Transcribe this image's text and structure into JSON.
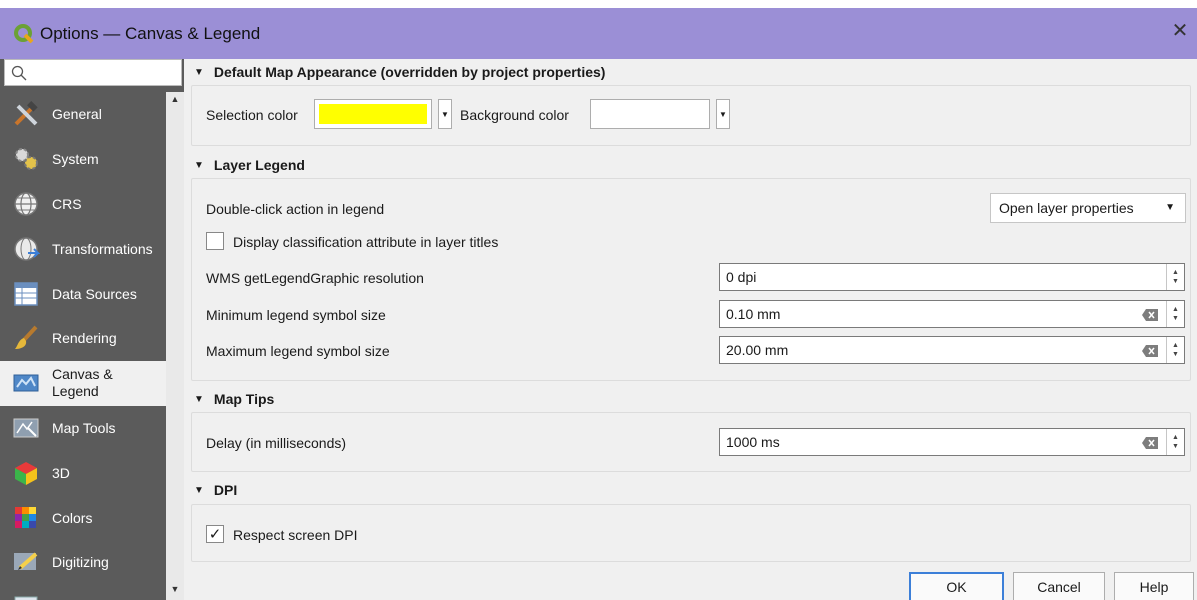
{
  "window": {
    "title": "Options — Canvas & Legend"
  },
  "search": {
    "placeholder": ""
  },
  "sidebar": {
    "items": [
      {
        "label": "General",
        "icon": "general-tools-icon"
      },
      {
        "label": "System",
        "icon": "system-gears-icon"
      },
      {
        "label": "CRS",
        "icon": "globe-icon"
      },
      {
        "label": "Transformations",
        "icon": "globe-transform-icon"
      },
      {
        "label": "Data Sources",
        "icon": "table-icon"
      },
      {
        "label": "Rendering",
        "icon": "brush-icon"
      },
      {
        "label": "Canvas &\nLegend",
        "icon": "map-canvas-icon"
      },
      {
        "label": "Map Tools",
        "icon": "map-tools-icon"
      },
      {
        "label": "3D",
        "icon": "cube-icon"
      },
      {
        "label": "Colors",
        "icon": "color-grid-icon"
      },
      {
        "label": "Digitizing",
        "icon": "digitizing-icon"
      },
      {
        "label": "",
        "icon": "layout-icon"
      }
    ],
    "active_index": 6
  },
  "sections": {
    "map_appearance": {
      "title": "Default Map Appearance (overridden by project properties)",
      "selection_label": "Selection color",
      "selection_color": "#ffff00",
      "background_label": "Background color",
      "background_color": "#ffffff"
    },
    "layer_legend": {
      "title": "Layer Legend",
      "double_click_label": "Double-click action in legend",
      "double_click_value": "Open layer properties",
      "classification_label": "Display classification attribute in layer titles",
      "classification_checked": false,
      "wms_label": "WMS getLegendGraphic resolution",
      "wms_value": "0 dpi",
      "min_label": "Minimum legend symbol size",
      "min_value": "0.10 mm",
      "max_label": "Maximum legend symbol size",
      "max_value": "20.00 mm"
    },
    "map_tips": {
      "title": "Map Tips",
      "delay_label": "Delay (in milliseconds)",
      "delay_value": "1000 ms"
    },
    "dpi": {
      "title": "DPI",
      "respect_label": "Respect screen DPI",
      "respect_checked": true,
      "check_mark": "✓"
    }
  },
  "buttons": {
    "ok": "OK",
    "cancel": "Cancel",
    "help": "Help"
  },
  "colors": {
    "titlebar": "#9b8fd6",
    "sidebar": "#5b5b5b",
    "accent": "#3c7fd8"
  }
}
